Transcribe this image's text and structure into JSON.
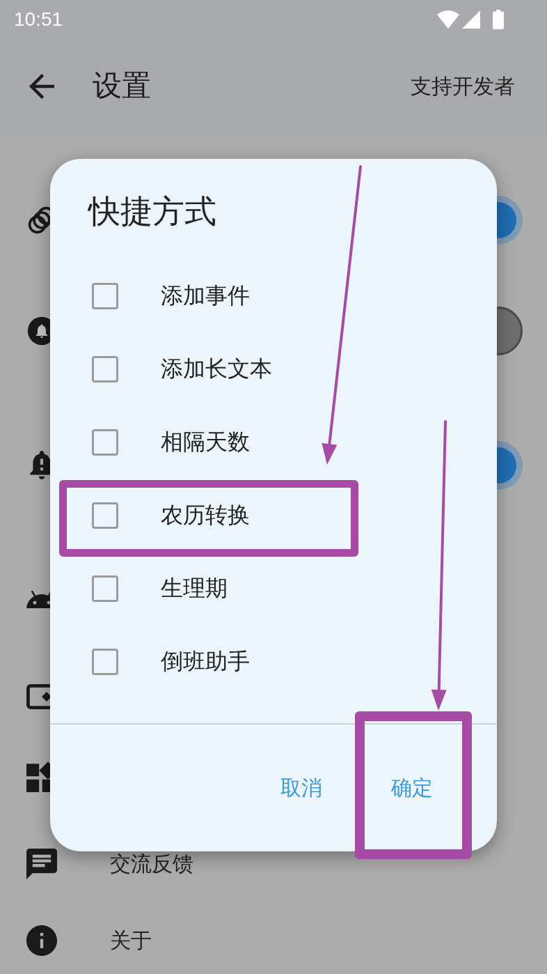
{
  "status_bar": {
    "time": "10:51"
  },
  "app_bar": {
    "title": "设置",
    "action": "支持开发者"
  },
  "settings_list": [
    {
      "kind": "toggle",
      "on": true
    },
    {
      "kind": "toggle",
      "on": false
    },
    {
      "kind": "toggle",
      "on": true
    },
    {
      "kind": "plain"
    },
    {
      "kind": "plain"
    },
    {
      "kind": "plain"
    },
    {
      "kind": "plain",
      "label": "交流反馈"
    },
    {
      "kind": "plain",
      "label": "关于"
    }
  ],
  "dialog": {
    "title": "快捷方式",
    "options": [
      {
        "label": "添加事件",
        "checked": false,
        "highlighted": false
      },
      {
        "label": "添加长文本",
        "checked": false,
        "highlighted": false
      },
      {
        "label": "相隔天数",
        "checked": false,
        "highlighted": false
      },
      {
        "label": "农历转换",
        "checked": false,
        "highlighted": true
      },
      {
        "label": "生理期",
        "checked": false,
        "highlighted": false
      },
      {
        "label": "倒班助手",
        "checked": false,
        "highlighted": false
      }
    ],
    "buttons": [
      {
        "label": "取消",
        "highlighted": false
      },
      {
        "label": "确定",
        "highlighted": true
      }
    ]
  }
}
